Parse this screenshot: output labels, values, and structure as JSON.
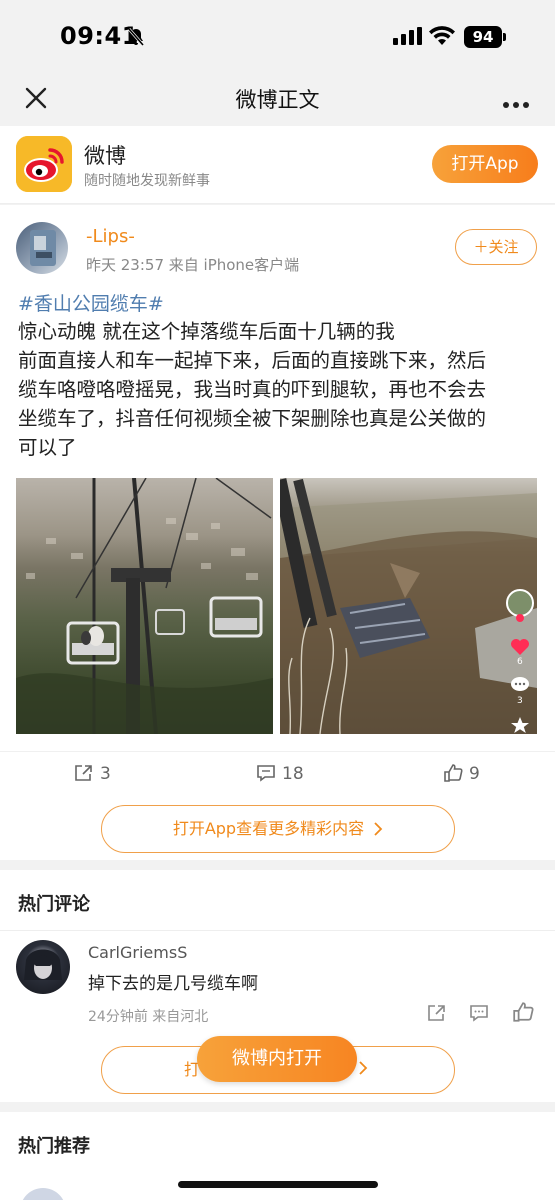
{
  "status_bar": {
    "time": "09:41",
    "battery": "94"
  },
  "nav": {
    "title": "微博正文"
  },
  "app_banner": {
    "name": "微博",
    "slogan": "随时随地发现新鲜事",
    "open_button": "打开App"
  },
  "post": {
    "author": "-Lips-",
    "meta": "昨天 23:57  来自 iPhone客户端",
    "follow_button": "＋关注",
    "topic": "#香山公园缆车#",
    "lines": [
      "惊心动魄 就在这个掉落缆车后面十几辆的我",
      "前面直接人和车一起掉下来，后面的直接跳下来，然后",
      "缆车咯噔咯噔摇晃，我当时真的吓到腿软，再也不会去",
      "坐缆车了，抖音任何视频全被下架删除也真是公关做的",
      "可以了"
    ],
    "photo_overlay": {
      "likes": "6",
      "comments": "3"
    },
    "actions": {
      "shares": "3",
      "comments": "18",
      "likes": "9"
    },
    "more_button": "打开App查看更多精彩内容"
  },
  "hot_comments": {
    "title": "热门评论",
    "comment": {
      "user": "CarlGriemsS",
      "text": "掉下去的是几号缆车啊",
      "meta": "24分钟前  来自河北"
    },
    "more_button_partial": "打"
  },
  "floating_button": "微博内打开",
  "recommend": {
    "title": "热门推荐"
  }
}
